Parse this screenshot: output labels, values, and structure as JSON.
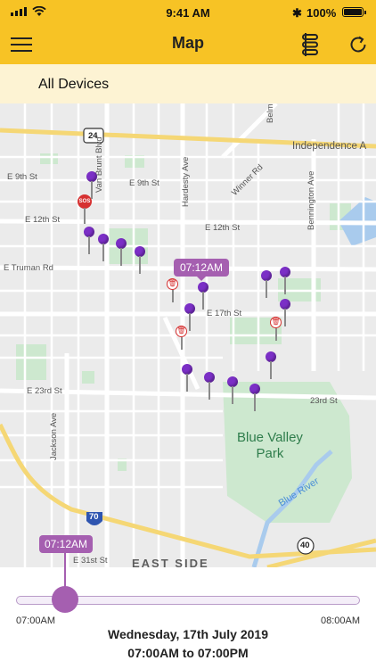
{
  "status": {
    "time": "9:41 AM",
    "battery": "100%"
  },
  "nav": {
    "title": "Map"
  },
  "device_filter": {
    "label": "All Devices"
  },
  "map": {
    "streets": [
      "E 9th St",
      "E 9th St",
      "E 12th St",
      "E 12th St",
      "E Truman Rd",
      "E 17th St",
      "E 23rd St",
      "23rd St",
      "E 31st St",
      "Van Brunt Blvd",
      "Hardesty Ave",
      "Winner Rd",
      "Bennington Ave",
      "Jackson Ave",
      "Independence A",
      "Belm"
    ],
    "shields": {
      "us24": "24",
      "i70": "70",
      "i70b": "70",
      "hwy40": "40"
    },
    "park_name": "Blue Valley\nPark",
    "river_name": "Blue River",
    "district": "EAST SIDE",
    "sos_label": "SOS",
    "bin_glyph": "🗑",
    "pin_bubble": "07:12AM",
    "colors": {
      "header": "#f7c325",
      "pin": "#7b2fc6",
      "bubble": "#a55fb0",
      "sos": "#d63131"
    }
  },
  "timeline": {
    "bubble": "07:12AM",
    "start": "07:00AM",
    "end": "08:00AM",
    "date": "Wednesday, 17th July 2019",
    "range": "07:00AM to 07:00PM",
    "position_fraction": 0.14
  }
}
